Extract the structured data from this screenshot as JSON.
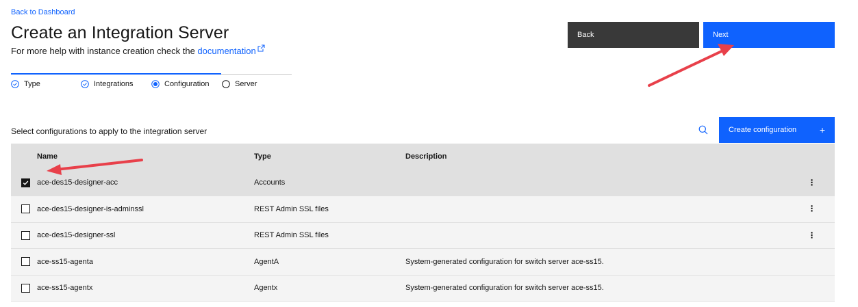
{
  "nav": {
    "back_link": "Back to Dashboard"
  },
  "header": {
    "title": "Create an Integration Server",
    "help_prefix": "For more help with instance creation check the ",
    "help_link": "documentation"
  },
  "actions": {
    "back_label": "Back",
    "next_label": "Next"
  },
  "progress": {
    "steps": [
      {
        "label": "Type",
        "state": "complete"
      },
      {
        "label": "Integrations",
        "state": "complete"
      },
      {
        "label": "Configuration",
        "state": "current"
      },
      {
        "label": "Server",
        "state": "incomplete"
      }
    ]
  },
  "config": {
    "section_label": "Select configurations to apply to the integration server",
    "create_label": "Create configuration",
    "create_icon": "+",
    "columns": [
      "Name",
      "Type",
      "Description"
    ],
    "rows": [
      {
        "name": "ace-des15-designer-acc",
        "type": "Accounts",
        "description": "",
        "checked": true,
        "has_menu": true
      },
      {
        "name": "ace-des15-designer-is-adminssl",
        "type": "REST Admin SSL files",
        "description": "",
        "checked": false,
        "has_menu": true
      },
      {
        "name": "ace-des15-designer-ssl",
        "type": "REST Admin SSL files",
        "description": "",
        "checked": false,
        "has_menu": true
      },
      {
        "name": "ace-ss15-agenta",
        "type": "AgentA",
        "description": "System-generated configuration for switch server ace-ss15.",
        "checked": false,
        "has_menu": false
      },
      {
        "name": "ace-ss15-agentx",
        "type": "Agentx",
        "description": "System-generated configuration for switch server ace-ss15.",
        "checked": false,
        "has_menu": false
      }
    ],
    "menu_glyph": "⋮"
  },
  "colors": {
    "primary": "#0f62fe",
    "secondary": "#393939",
    "annotation": "#e8404a"
  }
}
